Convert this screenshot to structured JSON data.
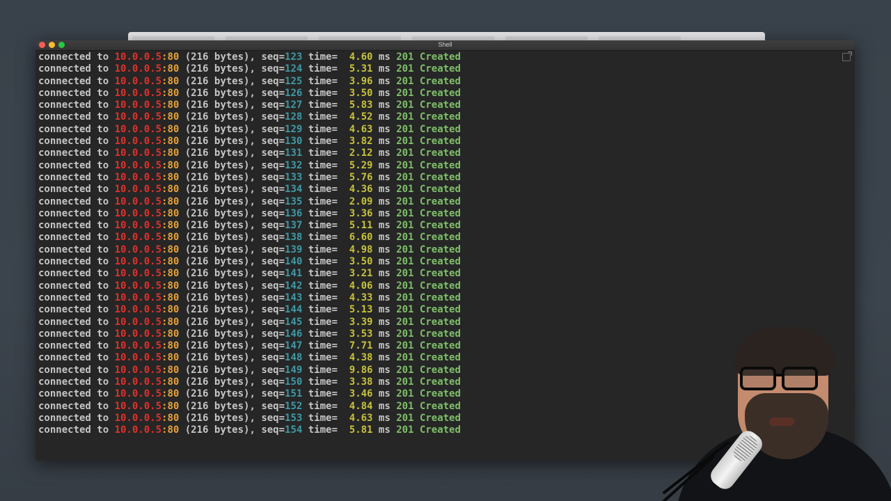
{
  "window": {
    "title": "Shell"
  },
  "colors": {
    "ip": "#e0312b",
    "port": "#e8a23a",
    "seq": "#3e9aa6",
    "time": "#c7c23c",
    "status": "#7fbf6a",
    "text": "#c6c6c6",
    "background": "#262626"
  },
  "terminal": {
    "lines": [
      {
        "prefix": "connected to ",
        "ip": "10.0.0.5",
        "port": ":80",
        "bytes": " (216 bytes), seq=",
        "seq": "123",
        "time_label": " time=  ",
        "time": "4.60",
        "unit": " ms ",
        "status": "201 Created"
      },
      {
        "prefix": "connected to ",
        "ip": "10.0.0.5",
        "port": ":80",
        "bytes": " (216 bytes), seq=",
        "seq": "124",
        "time_label": " time=  ",
        "time": "5.31",
        "unit": " ms ",
        "status": "201 Created"
      },
      {
        "prefix": "connected to ",
        "ip": "10.0.0.5",
        "port": ":80",
        "bytes": " (216 bytes), seq=",
        "seq": "125",
        "time_label": " time=  ",
        "time": "3.96",
        "unit": " ms ",
        "status": "201 Created"
      },
      {
        "prefix": "connected to ",
        "ip": "10.0.0.5",
        "port": ":80",
        "bytes": " (216 bytes), seq=",
        "seq": "126",
        "time_label": " time=  ",
        "time": "3.50",
        "unit": " ms ",
        "status": "201 Created"
      },
      {
        "prefix": "connected to ",
        "ip": "10.0.0.5",
        "port": ":80",
        "bytes": " (216 bytes), seq=",
        "seq": "127",
        "time_label": " time=  ",
        "time": "5.83",
        "unit": " ms ",
        "status": "201 Created"
      },
      {
        "prefix": "connected to ",
        "ip": "10.0.0.5",
        "port": ":80",
        "bytes": " (216 bytes), seq=",
        "seq": "128",
        "time_label": " time=  ",
        "time": "4.52",
        "unit": " ms ",
        "status": "201 Created"
      },
      {
        "prefix": "connected to ",
        "ip": "10.0.0.5",
        "port": ":80",
        "bytes": " (216 bytes), seq=",
        "seq": "129",
        "time_label": " time=  ",
        "time": "4.63",
        "unit": " ms ",
        "status": "201 Created"
      },
      {
        "prefix": "connected to ",
        "ip": "10.0.0.5",
        "port": ":80",
        "bytes": " (216 bytes), seq=",
        "seq": "130",
        "time_label": " time=  ",
        "time": "3.82",
        "unit": " ms ",
        "status": "201 Created"
      },
      {
        "prefix": "connected to ",
        "ip": "10.0.0.5",
        "port": ":80",
        "bytes": " (216 bytes), seq=",
        "seq": "131",
        "time_label": " time=  ",
        "time": "2.12",
        "unit": " ms ",
        "status": "201 Created"
      },
      {
        "prefix": "connected to ",
        "ip": "10.0.0.5",
        "port": ":80",
        "bytes": " (216 bytes), seq=",
        "seq": "132",
        "time_label": " time=  ",
        "time": "5.29",
        "unit": " ms ",
        "status": "201 Created"
      },
      {
        "prefix": "connected to ",
        "ip": "10.0.0.5",
        "port": ":80",
        "bytes": " (216 bytes), seq=",
        "seq": "133",
        "time_label": " time=  ",
        "time": "5.76",
        "unit": " ms ",
        "status": "201 Created"
      },
      {
        "prefix": "connected to ",
        "ip": "10.0.0.5",
        "port": ":80",
        "bytes": " (216 bytes), seq=",
        "seq": "134",
        "time_label": " time=  ",
        "time": "4.36",
        "unit": " ms ",
        "status": "201 Created"
      },
      {
        "prefix": "connected to ",
        "ip": "10.0.0.5",
        "port": ":80",
        "bytes": " (216 bytes), seq=",
        "seq": "135",
        "time_label": " time=  ",
        "time": "2.09",
        "unit": " ms ",
        "status": "201 Created"
      },
      {
        "prefix": "connected to ",
        "ip": "10.0.0.5",
        "port": ":80",
        "bytes": " (216 bytes), seq=",
        "seq": "136",
        "time_label": " time=  ",
        "time": "3.36",
        "unit": " ms ",
        "status": "201 Created"
      },
      {
        "prefix": "connected to ",
        "ip": "10.0.0.5",
        "port": ":80",
        "bytes": " (216 bytes), seq=",
        "seq": "137",
        "time_label": " time=  ",
        "time": "5.11",
        "unit": " ms ",
        "status": "201 Created"
      },
      {
        "prefix": "connected to ",
        "ip": "10.0.0.5",
        "port": ":80",
        "bytes": " (216 bytes), seq=",
        "seq": "138",
        "time_label": " time=  ",
        "time": "6.60",
        "unit": " ms ",
        "status": "201 Created"
      },
      {
        "prefix": "connected to ",
        "ip": "10.0.0.5",
        "port": ":80",
        "bytes": " (216 bytes), seq=",
        "seq": "139",
        "time_label": " time=  ",
        "time": "4.98",
        "unit": " ms ",
        "status": "201 Created"
      },
      {
        "prefix": "connected to ",
        "ip": "10.0.0.5",
        "port": ":80",
        "bytes": " (216 bytes), seq=",
        "seq": "140",
        "time_label": " time=  ",
        "time": "3.50",
        "unit": " ms ",
        "status": "201 Created"
      },
      {
        "prefix": "connected to ",
        "ip": "10.0.0.5",
        "port": ":80",
        "bytes": " (216 bytes), seq=",
        "seq": "141",
        "time_label": " time=  ",
        "time": "3.21",
        "unit": " ms ",
        "status": "201 Created"
      },
      {
        "prefix": "connected to ",
        "ip": "10.0.0.5",
        "port": ":80",
        "bytes": " (216 bytes), seq=",
        "seq": "142",
        "time_label": " time=  ",
        "time": "4.06",
        "unit": " ms ",
        "status": "201 Created"
      },
      {
        "prefix": "connected to ",
        "ip": "10.0.0.5",
        "port": ":80",
        "bytes": " (216 bytes), seq=",
        "seq": "143",
        "time_label": " time=  ",
        "time": "4.33",
        "unit": " ms ",
        "status": "201 Created"
      },
      {
        "prefix": "connected to ",
        "ip": "10.0.0.5",
        "port": ":80",
        "bytes": " (216 bytes), seq=",
        "seq": "144",
        "time_label": " time=  ",
        "time": "5.13",
        "unit": " ms ",
        "status": "201 Created"
      },
      {
        "prefix": "connected to ",
        "ip": "10.0.0.5",
        "port": ":80",
        "bytes": " (216 bytes), seq=",
        "seq": "145",
        "time_label": " time=  ",
        "time": "3.39",
        "unit": " ms ",
        "status": "201 Created"
      },
      {
        "prefix": "connected to ",
        "ip": "10.0.0.5",
        "port": ":80",
        "bytes": " (216 bytes), seq=",
        "seq": "146",
        "time_label": " time=  ",
        "time": "3.53",
        "unit": " ms ",
        "status": "201 Created"
      },
      {
        "prefix": "connected to ",
        "ip": "10.0.0.5",
        "port": ":80",
        "bytes": " (216 bytes), seq=",
        "seq": "147",
        "time_label": " time=  ",
        "time": "7.71",
        "unit": " ms ",
        "status": "201 Created"
      },
      {
        "prefix": "connected to ",
        "ip": "10.0.0.5",
        "port": ":80",
        "bytes": " (216 bytes), seq=",
        "seq": "148",
        "time_label": " time=  ",
        "time": "4.38",
        "unit": " ms ",
        "status": "201 Created"
      },
      {
        "prefix": "connected to ",
        "ip": "10.0.0.5",
        "port": ":80",
        "bytes": " (216 bytes), seq=",
        "seq": "149",
        "time_label": " time=  ",
        "time": "9.86",
        "unit": " ms ",
        "status": "201 Created"
      },
      {
        "prefix": "connected to ",
        "ip": "10.0.0.5",
        "port": ":80",
        "bytes": " (216 bytes), seq=",
        "seq": "150",
        "time_label": " time=  ",
        "time": "3.38",
        "unit": " ms ",
        "status": "201 Created"
      },
      {
        "prefix": "connected to ",
        "ip": "10.0.0.5",
        "port": ":80",
        "bytes": " (216 bytes), seq=",
        "seq": "151",
        "time_label": " time=  ",
        "time": "3.46",
        "unit": " ms ",
        "status": "201 Created"
      },
      {
        "prefix": "connected to ",
        "ip": "10.0.0.5",
        "port": ":80",
        "bytes": " (216 bytes), seq=",
        "seq": "152",
        "time_label": " time=  ",
        "time": "4.84",
        "unit": " ms ",
        "status": "201 Created"
      },
      {
        "prefix": "connected to ",
        "ip": "10.0.0.5",
        "port": ":80",
        "bytes": " (216 bytes), seq=",
        "seq": "153",
        "time_label": " time=  ",
        "time": "4.63",
        "unit": " ms ",
        "status": "201 Created"
      },
      {
        "prefix": "connected to ",
        "ip": "10.0.0.5",
        "port": ":80",
        "bytes": " (216 bytes), seq=",
        "seq": "154",
        "time_label": " time=  ",
        "time": "5.81",
        "unit": " ms ",
        "status": "201 Created"
      }
    ]
  },
  "icons": {
    "popout": "popout-icon",
    "close": "close-icon",
    "minimize": "minimize-icon",
    "zoom": "zoom-icon"
  }
}
